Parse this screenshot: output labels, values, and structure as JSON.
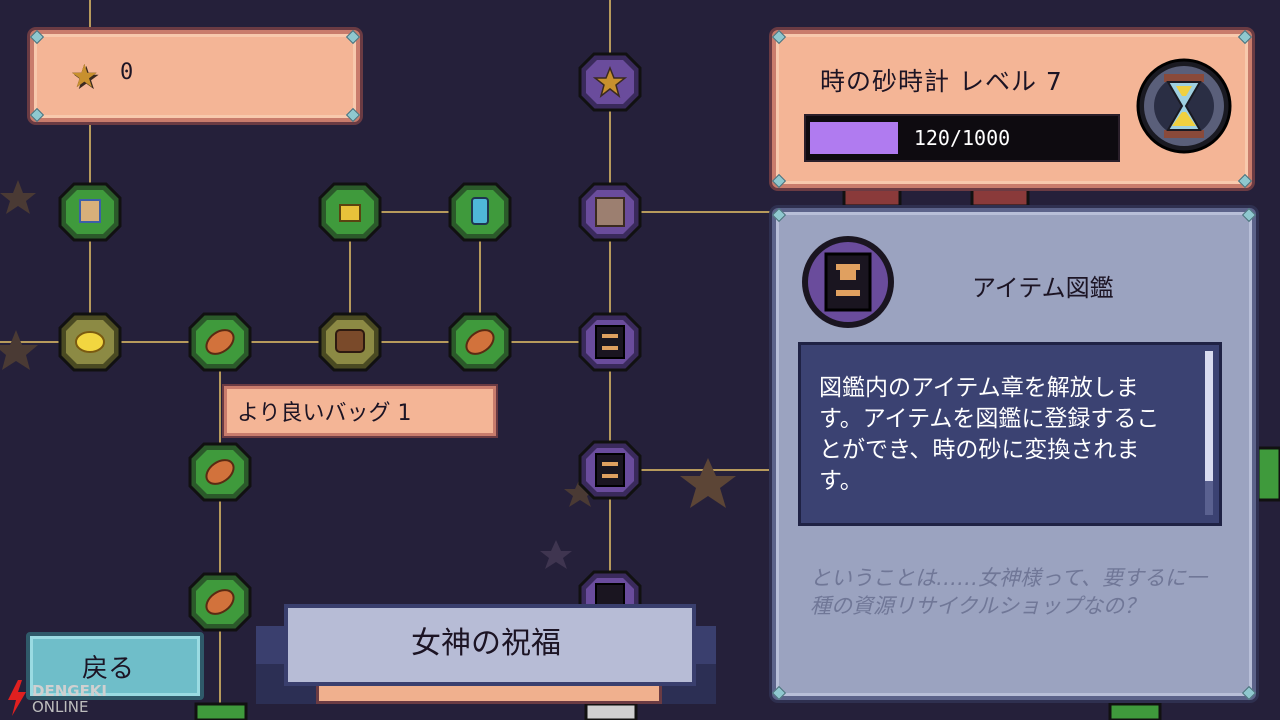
{
  "stars": {
    "icon": "star-icon",
    "count": "0"
  },
  "level": {
    "title": "時の砂時計 レベル 7",
    "progress_text": "120/1000",
    "progress_fraction": 0.12,
    "icon": "hourglass-icon"
  },
  "item_info": {
    "icon": "item-encyclopedia-icon",
    "title": "アイテム図鑑",
    "description": "図鑑内のアイテム章を解放します。アイテムを図鑑に登録することができ、時の砂に変換されます。",
    "flavor": "ということは……女神様って、要するに一種の資源リサイクルショップなの？"
  },
  "tooltip": {
    "label": "より良いバッグ 1"
  },
  "back_button": {
    "label": "戻る"
  },
  "banner": {
    "title": "女神の祝福"
  },
  "watermark": {
    "line1": "DENGEKI",
    "line2": "ONLINE"
  },
  "colors": {
    "background": "#25203a",
    "node_green": "#3f9a3c",
    "node_gold": "#8c8a44",
    "node_purple": "#6a4c9c",
    "connector": "#b79a5c",
    "panel_peach": "#f4b596",
    "panel_blue": "#9ba3c0",
    "progress_fill": "#b07bf0"
  }
}
